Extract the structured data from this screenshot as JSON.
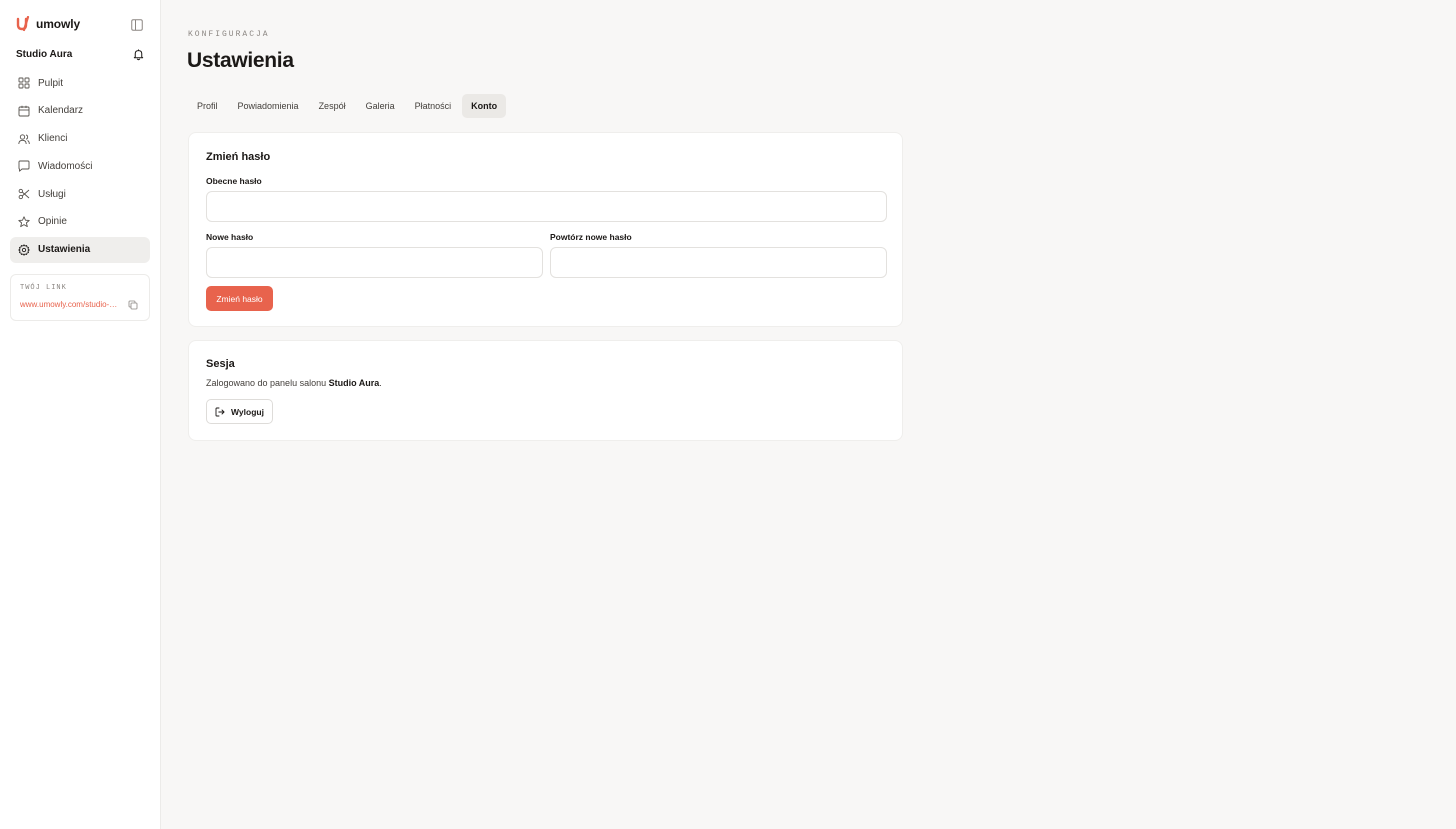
{
  "brand": {
    "name": "umowly",
    "accent": "#e8634d"
  },
  "studio": {
    "name": "Studio Aura"
  },
  "sidebar": {
    "items": [
      {
        "label": "Pulpit",
        "icon": "dashboard-icon"
      },
      {
        "label": "Kalendarz",
        "icon": "calendar-icon"
      },
      {
        "label": "Klienci",
        "icon": "users-icon"
      },
      {
        "label": "Wiadomości",
        "icon": "message-icon"
      },
      {
        "label": "Usługi",
        "icon": "scissors-icon"
      },
      {
        "label": "Opinie",
        "icon": "star-icon"
      },
      {
        "label": "Ustawienia",
        "icon": "gear-icon",
        "active": true
      }
    ],
    "link": {
      "label": "TWÓJ LINK",
      "url": "www.umowly.com/studio-aura"
    }
  },
  "page": {
    "eyebrow": "KONFIGURACJA",
    "title": "Ustawienia"
  },
  "tabs": [
    {
      "label": "Profil"
    },
    {
      "label": "Powiadomienia"
    },
    {
      "label": "Zespół"
    },
    {
      "label": "Galeria"
    },
    {
      "label": "Płatności"
    },
    {
      "label": "Konto",
      "active": true
    }
  ],
  "password": {
    "title": "Zmień hasło",
    "current_label": "Obecne hasło",
    "current_value": "",
    "new_label": "Nowe hasło",
    "new_value": "",
    "repeat_label": "Powtórz nowe hasło",
    "repeat_value": "",
    "submit_label": "Zmień hasło"
  },
  "session": {
    "title": "Sesja",
    "text_prefix": "Zalogowano do panelu salonu ",
    "salon_name": "Studio Aura",
    "text_suffix": ".",
    "logout_label": "Wyloguj"
  }
}
